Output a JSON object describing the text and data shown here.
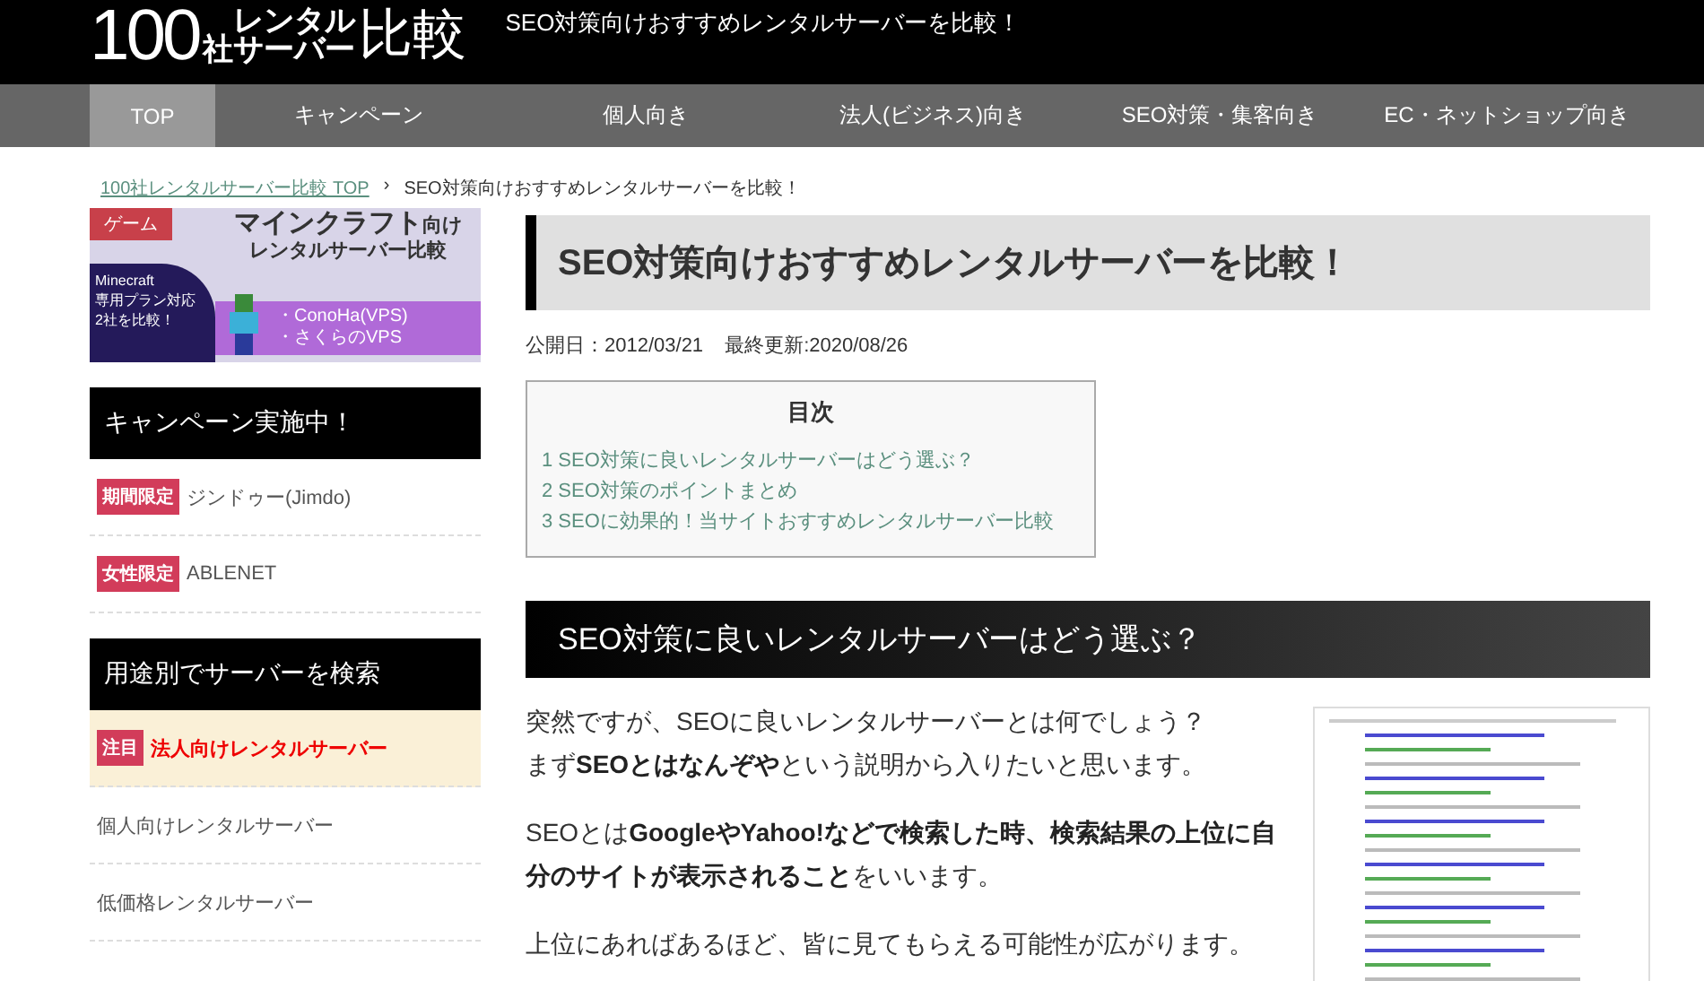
{
  "header": {
    "logo": {
      "number": "100",
      "kanji": "社",
      "top": "レンタル",
      "bottom": "サーバー",
      "tail": "比較"
    },
    "tagline": "SEO対策向けおすすめレンタルサーバーを比較！"
  },
  "nav": [
    {
      "label": "TOP",
      "selected": true
    },
    {
      "label": "キャンペーン",
      "selected": false
    },
    {
      "label": "個人向き",
      "selected": false
    },
    {
      "label": "法人(ビジネス)向き",
      "selected": false
    },
    {
      "label": "SEO対策・集客向き",
      "selected": false
    },
    {
      "label": "EC・ネットショップ向き",
      "selected": false
    }
  ],
  "breadcrumb": [
    {
      "label": "100社レンタルサーバー比較 TOP",
      "kind": "link"
    },
    {
      "label": "›",
      "kind": "separator"
    },
    {
      "label": "SEO対策向けおすすめレンタルサーバーを比較！",
      "kind": "current"
    }
  ],
  "sidebar": {
    "banner": {
      "tag": "ゲーム",
      "title_main": "マインクラフト",
      "title_suffix": "向け",
      "subtitle": "レンタルサーバー比較",
      "side_lines": [
        "Minecraft",
        "専用プラン対応",
        "2社を比較！"
      ],
      "servers": [
        "・ConoHa(VPS)",
        "・さくらのVPS"
      ]
    },
    "sections": [
      {
        "title": "キャンペーン実施中！",
        "items": [
          {
            "badge": "期間限定",
            "label": "ジンドゥー(Jimdo)",
            "featured": false
          },
          {
            "badge": "女性限定",
            "label": "ABLENET",
            "featured": false
          }
        ]
      },
      {
        "title": "用途別でサーバーを検索",
        "items": [
          {
            "badge": "注目",
            "label": "法人向けレンタルサーバー",
            "featured": true
          },
          {
            "label": "個人向けレンタルサーバー",
            "featured": false
          },
          {
            "label": "低価格レンタルサーバー",
            "featured": false
          }
        ]
      }
    ]
  },
  "article": {
    "title": "SEO対策向けおすすめレンタルサーバーを比較！",
    "published": "公開日：2012/03/21",
    "updated": "最終更新:2020/08/26",
    "toc": {
      "title": "目次",
      "items": [
        "1 SEO対策に良いレンタルサーバーはどう選ぶ？",
        "2 SEO対策のポイントまとめ",
        "3 SEOに効果的！当サイトおすすめレンタルサーバー比較"
      ]
    },
    "heading": "SEO対策に良いレンタルサーバーはどう選ぶ？",
    "paragraphs": [
      [
        "突然ですが、SEOに良いレンタルサーバーとは何でしょう？",
        "まず**SEOとはなんぞや**という説明から入りたいと思います。"
      ],
      [
        "SEOとは**GoogleやYahoo!などで検索した時、検索結果の上位に自分のサイトが表示されること**をいいます。"
      ],
      [
        "上位にあればあるほど、皆に見てもらえる可能性が広がります。"
      ]
    ]
  }
}
